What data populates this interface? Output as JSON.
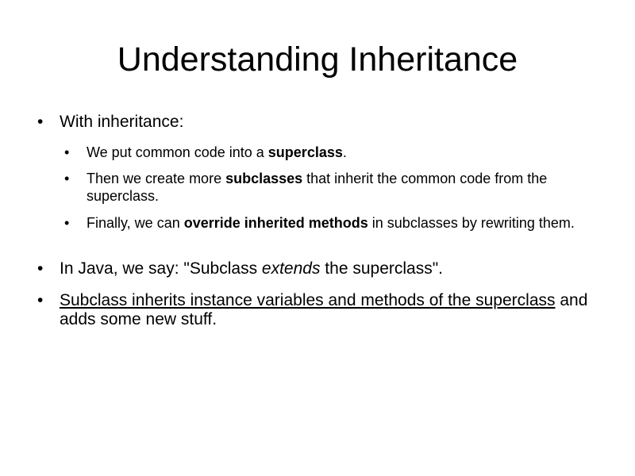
{
  "slide": {
    "title": "Understanding Inheritance",
    "bullet_char": "•",
    "items": [
      {
        "level": 1,
        "parts": [
          {
            "text": "With inheritance:"
          }
        ]
      },
      {
        "level": 2,
        "parts": [
          {
            "text": "We put common code into a "
          },
          {
            "text": "superclass",
            "bold": true
          },
          {
            "text": "."
          }
        ]
      },
      {
        "level": 2,
        "parts": [
          {
            "text": "Then we create more "
          },
          {
            "text": "subclasses",
            "bold": true
          },
          {
            "text": " that inherit the common code from the superclass."
          }
        ]
      },
      {
        "level": 2,
        "parts": [
          {
            "text": "Finally, we can "
          },
          {
            "text": "override inherited methods",
            "bold": true
          },
          {
            "text": " in subclasses by rewriting them."
          }
        ]
      },
      {
        "level": 1,
        "parts": [
          {
            "text": "In Java, we say: \"Subclass "
          },
          {
            "text": "extends",
            "italic": true
          },
          {
            "text": " the superclass\"."
          }
        ]
      },
      {
        "level": 1,
        "parts": [
          {
            "text": "Subclass inherits instance variables and methods of the superclass",
            "underline": true
          },
          {
            "text": " and adds some new stuff."
          }
        ]
      }
    ]
  }
}
